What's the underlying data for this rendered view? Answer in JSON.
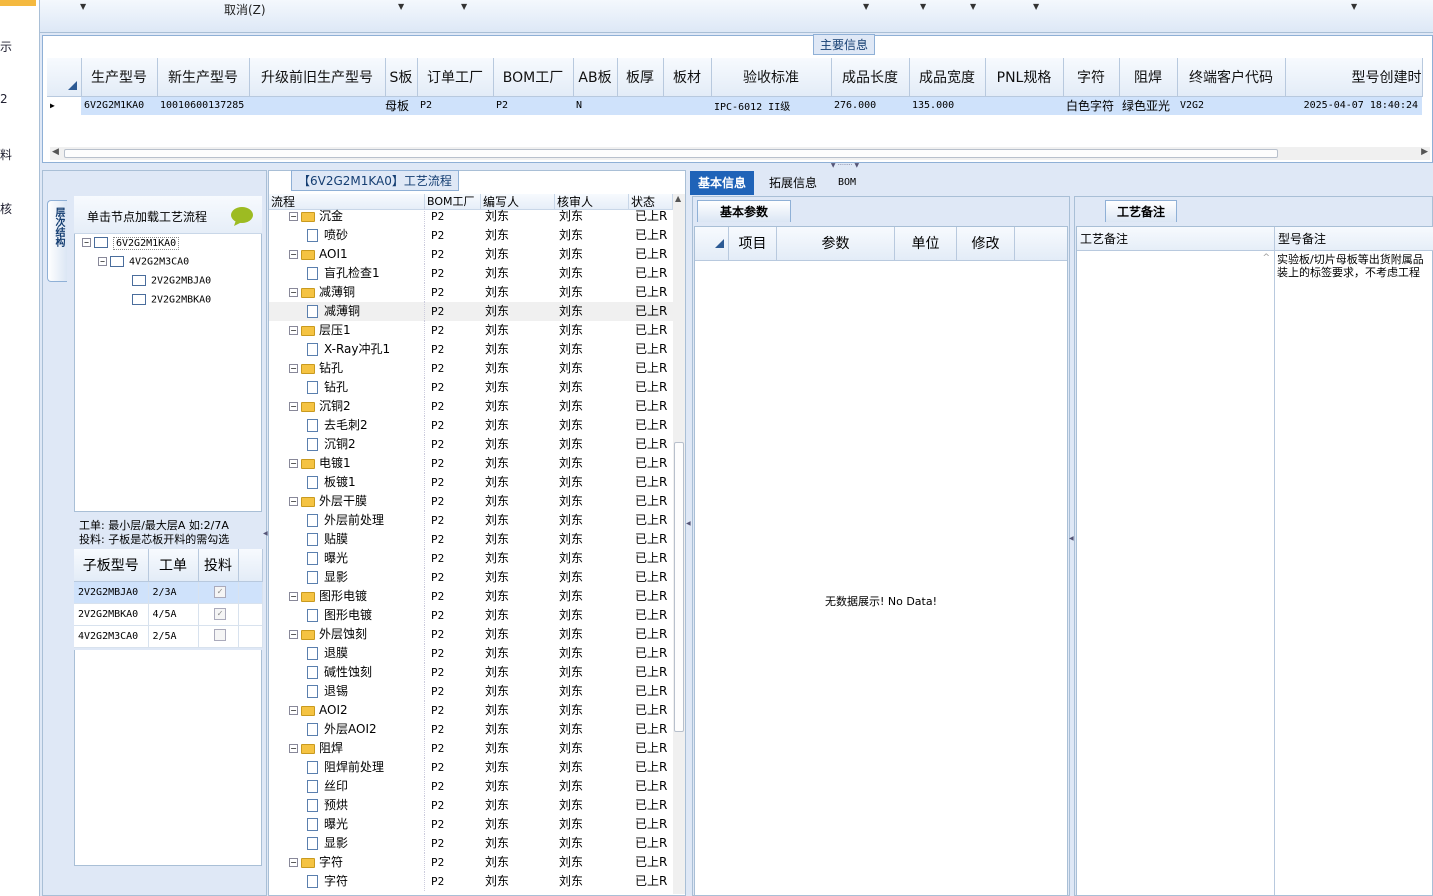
{
  "left_strip": {
    "items": [
      "示",
      "2",
      "料",
      "核"
    ]
  },
  "toolbar": {
    "cancel_label": "取消(Z)"
  },
  "main_info": {
    "group_title": "主要信息",
    "columns": [
      "生产型号",
      "新生产型号",
      "升级前旧生产型号",
      "S板",
      "订单工厂",
      "BOM工厂",
      "AB板",
      "板厚",
      "板材",
      "验收标准",
      "成品长度",
      "成品宽度",
      "PNL规格",
      "字符",
      "阻焊",
      "终端客户代码",
      "型号创建时"
    ],
    "row": [
      "6V2G2M1KA0",
      "10010600137285",
      "",
      "母板",
      "P2",
      "P2",
      "N",
      "",
      "",
      "IPC-6012 II级",
      "276.000",
      "135.000",
      "",
      "白色字符",
      "绿色亚光",
      "V2G2",
      "2025-04-07 18:40:24"
    ]
  },
  "structure": {
    "side_tab": "层次结构",
    "hint": "单击节点加载工艺流程",
    "nodes": [
      "6V2G2M1KA0",
      "4V2G2M3CA0",
      "2V2G2MBJA0",
      "2V2G2MBKA0"
    ],
    "note1": "工单: 最小层/最大层A 如:2/7A",
    "note2": "投料: 子板是芯板开料的需勾选",
    "sub_columns": [
      "子板型号",
      "工单",
      "投料"
    ],
    "sub_rows": [
      {
        "model": "2V2G2MBJA0",
        "order": "2/3A",
        "checked": "✓"
      },
      {
        "model": "2V2G2MBKA0",
        "order": "4/5A",
        "checked": "✓"
      },
      {
        "model": "4V2G2M3CA0",
        "order": "2/5A",
        "checked": ""
      }
    ]
  },
  "process": {
    "title": "【6V2G2M1KA0】工艺流程",
    "columns": [
      "流程",
      "BOM工厂",
      "编写人",
      "核审人",
      "状态"
    ],
    "rows": [
      {
        "name": "沉金",
        "level": 0,
        "bom": "P2",
        "writer": "刘东",
        "reviewer": "刘东",
        "status": "已上R"
      },
      {
        "name": "喷砂",
        "level": 1,
        "bom": "P2",
        "writer": "刘东",
        "reviewer": "刘东",
        "status": "已上R"
      },
      {
        "name": "AOI1",
        "level": 0,
        "bom": "P2",
        "writer": "刘东",
        "reviewer": "刘东",
        "status": "已上R"
      },
      {
        "name": "盲孔检查1",
        "level": 1,
        "bom": "P2",
        "writer": "刘东",
        "reviewer": "刘东",
        "status": "已上R"
      },
      {
        "name": "减薄铜",
        "level": 0,
        "bom": "P2",
        "writer": "刘东",
        "reviewer": "刘东",
        "status": "已上R"
      },
      {
        "name": "减薄铜",
        "level": 1,
        "bom": "P2",
        "writer": "刘东",
        "reviewer": "刘东",
        "status": "已上R"
      },
      {
        "name": "层压1",
        "level": 0,
        "bom": "P2",
        "writer": "刘东",
        "reviewer": "刘东",
        "status": "已上R"
      },
      {
        "name": "X-Ray冲孔1",
        "level": 1,
        "bom": "P2",
        "writer": "刘东",
        "reviewer": "刘东",
        "status": "已上R"
      },
      {
        "name": "钻孔",
        "level": 0,
        "bom": "P2",
        "writer": "刘东",
        "reviewer": "刘东",
        "status": "已上R"
      },
      {
        "name": "钻孔",
        "level": 1,
        "bom": "P2",
        "writer": "刘东",
        "reviewer": "刘东",
        "status": "已上R"
      },
      {
        "name": "沉铜2",
        "level": 0,
        "bom": "P2",
        "writer": "刘东",
        "reviewer": "刘东",
        "status": "已上R"
      },
      {
        "name": "去毛刺2",
        "level": 1,
        "bom": "P2",
        "writer": "刘东",
        "reviewer": "刘东",
        "status": "已上R"
      },
      {
        "name": "沉铜2",
        "level": 1,
        "bom": "P2",
        "writer": "刘东",
        "reviewer": "刘东",
        "status": "已上R"
      },
      {
        "name": "电镀1",
        "level": 0,
        "bom": "P2",
        "writer": "刘东",
        "reviewer": "刘东",
        "status": "已上R"
      },
      {
        "name": "板镀1",
        "level": 1,
        "bom": "P2",
        "writer": "刘东",
        "reviewer": "刘东",
        "status": "已上R"
      },
      {
        "name": "外层干膜",
        "level": 0,
        "bom": "P2",
        "writer": "刘东",
        "reviewer": "刘东",
        "status": "已上R"
      },
      {
        "name": "外层前处理",
        "level": 1,
        "bom": "P2",
        "writer": "刘东",
        "reviewer": "刘东",
        "status": "已上R"
      },
      {
        "name": "贴膜",
        "level": 1,
        "bom": "P2",
        "writer": "刘东",
        "reviewer": "刘东",
        "status": "已上R"
      },
      {
        "name": "曝光",
        "level": 1,
        "bom": "P2",
        "writer": "刘东",
        "reviewer": "刘东",
        "status": "已上R"
      },
      {
        "name": "显影",
        "level": 1,
        "bom": "P2",
        "writer": "刘东",
        "reviewer": "刘东",
        "status": "已上R"
      },
      {
        "name": "图形电镀",
        "level": 0,
        "bom": "P2",
        "writer": "刘东",
        "reviewer": "刘东",
        "status": "已上R"
      },
      {
        "name": "图形电镀",
        "level": 1,
        "bom": "P2",
        "writer": "刘东",
        "reviewer": "刘东",
        "status": "已上R"
      },
      {
        "name": "外层蚀刻",
        "level": 0,
        "bom": "P2",
        "writer": "刘东",
        "reviewer": "刘东",
        "status": "已上R"
      },
      {
        "name": "退膜",
        "level": 1,
        "bom": "P2",
        "writer": "刘东",
        "reviewer": "刘东",
        "status": "已上R"
      },
      {
        "name": "碱性蚀刻",
        "level": 1,
        "bom": "P2",
        "writer": "刘东",
        "reviewer": "刘东",
        "status": "已上R"
      },
      {
        "name": "退锡",
        "level": 1,
        "bom": "P2",
        "writer": "刘东",
        "reviewer": "刘东",
        "status": "已上R"
      },
      {
        "name": "AOI2",
        "level": 0,
        "bom": "P2",
        "writer": "刘东",
        "reviewer": "刘东",
        "status": "已上R"
      },
      {
        "name": "外层AOI2",
        "level": 1,
        "bom": "P2",
        "writer": "刘东",
        "reviewer": "刘东",
        "status": "已上R"
      },
      {
        "name": "阻焊",
        "level": 0,
        "bom": "P2",
        "writer": "刘东",
        "reviewer": "刘东",
        "status": "已上R"
      },
      {
        "name": "阻焊前处理",
        "level": 1,
        "bom": "P2",
        "writer": "刘东",
        "reviewer": "刘东",
        "status": "已上R"
      },
      {
        "name": "丝印",
        "level": 1,
        "bom": "P2",
        "writer": "刘东",
        "reviewer": "刘东",
        "status": "已上R"
      },
      {
        "name": "预烘",
        "level": 1,
        "bom": "P2",
        "writer": "刘东",
        "reviewer": "刘东",
        "status": "已上R"
      },
      {
        "name": "曝光",
        "level": 1,
        "bom": "P2",
        "writer": "刘东",
        "reviewer": "刘东",
        "status": "已上R"
      },
      {
        "name": "显影",
        "level": 1,
        "bom": "P2",
        "writer": "刘东",
        "reviewer": "刘东",
        "status": "已上R"
      },
      {
        "name": "字符",
        "level": 0,
        "bom": "P2",
        "writer": "刘东",
        "reviewer": "刘东",
        "status": "已上R"
      },
      {
        "name": "字符",
        "level": 1,
        "bom": "P2",
        "writer": "刘东",
        "reviewer": "刘东",
        "status": "已上R"
      }
    ]
  },
  "right_tabs": [
    "基本信息",
    "拓展信息",
    "BOM"
  ],
  "basic": {
    "subtab": "基本参数",
    "columns": [
      "项目",
      "参数",
      "单位",
      "修改"
    ],
    "empty": "无数据展示! No Data!"
  },
  "notes": {
    "subtab": "工艺备注",
    "col1": "工艺备注",
    "col2": "型号备注",
    "remark": "实验板/切片母板等出货附属品装上的标签要求，不考虑工程"
  },
  "colors": {
    "accent": "#1f63b8",
    "selected_row": "#cfe2fb",
    "folder": "#f5c342"
  }
}
